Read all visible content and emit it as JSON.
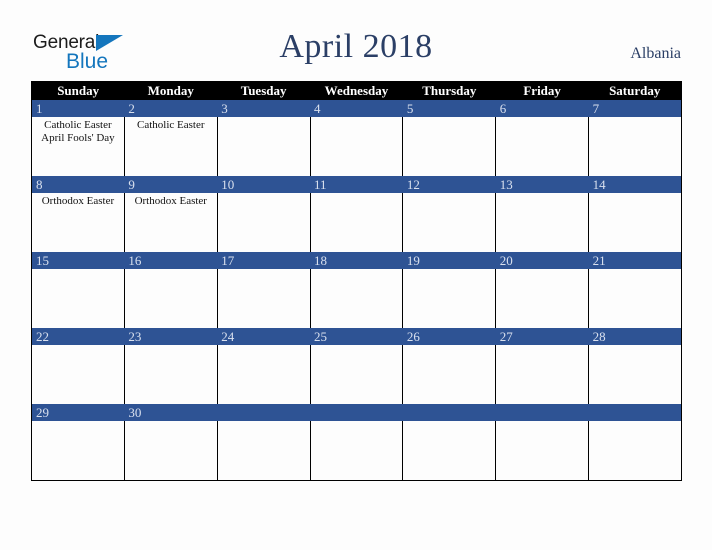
{
  "page": {
    "background_color": "#fdfdfd"
  },
  "brand": {
    "logo_name": "general-blue-logo",
    "word_general": "General",
    "word_blue": "Blue",
    "general_color": "#1c1c1c",
    "blue_color": "#1476bd"
  },
  "header": {
    "title": "April 2018",
    "country": "Albania",
    "title_color": "#2b3f66"
  },
  "calendar": {
    "header_bg": "#000000",
    "header_text_color": "#ffffff",
    "daynum_bg": "#2e5394",
    "daynum_text_color": "#d9e0ee",
    "grid_color": "#000000",
    "weekday_headers": [
      "Sunday",
      "Monday",
      "Tuesday",
      "Wednesday",
      "Thursday",
      "Friday",
      "Saturday"
    ],
    "weeks": [
      {
        "days": [
          {
            "number": "1",
            "events": [
              "Catholic Easter",
              "April Fools' Day"
            ]
          },
          {
            "number": "2",
            "events": [
              "Catholic Easter"
            ]
          },
          {
            "number": "3",
            "events": []
          },
          {
            "number": "4",
            "events": []
          },
          {
            "number": "5",
            "events": []
          },
          {
            "number": "6",
            "events": []
          },
          {
            "number": "7",
            "events": []
          }
        ]
      },
      {
        "days": [
          {
            "number": "8",
            "events": [
              "Orthodox Easter"
            ]
          },
          {
            "number": "9",
            "events": [
              "Orthodox Easter"
            ]
          },
          {
            "number": "10",
            "events": []
          },
          {
            "number": "11",
            "events": []
          },
          {
            "number": "12",
            "events": []
          },
          {
            "number": "13",
            "events": []
          },
          {
            "number": "14",
            "events": []
          }
        ]
      },
      {
        "days": [
          {
            "number": "15",
            "events": []
          },
          {
            "number": "16",
            "events": []
          },
          {
            "number": "17",
            "events": []
          },
          {
            "number": "18",
            "events": []
          },
          {
            "number": "19",
            "events": []
          },
          {
            "number": "20",
            "events": []
          },
          {
            "number": "21",
            "events": []
          }
        ]
      },
      {
        "days": [
          {
            "number": "22",
            "events": []
          },
          {
            "number": "23",
            "events": []
          },
          {
            "number": "24",
            "events": []
          },
          {
            "number": "25",
            "events": []
          },
          {
            "number": "26",
            "events": []
          },
          {
            "number": "27",
            "events": []
          },
          {
            "number": "28",
            "events": []
          }
        ]
      },
      {
        "days": [
          {
            "number": "29",
            "events": []
          },
          {
            "number": "30",
            "events": []
          },
          {
            "number": "",
            "events": []
          },
          {
            "number": "",
            "events": []
          },
          {
            "number": "",
            "events": []
          },
          {
            "number": "",
            "events": []
          },
          {
            "number": "",
            "events": []
          }
        ]
      }
    ]
  }
}
